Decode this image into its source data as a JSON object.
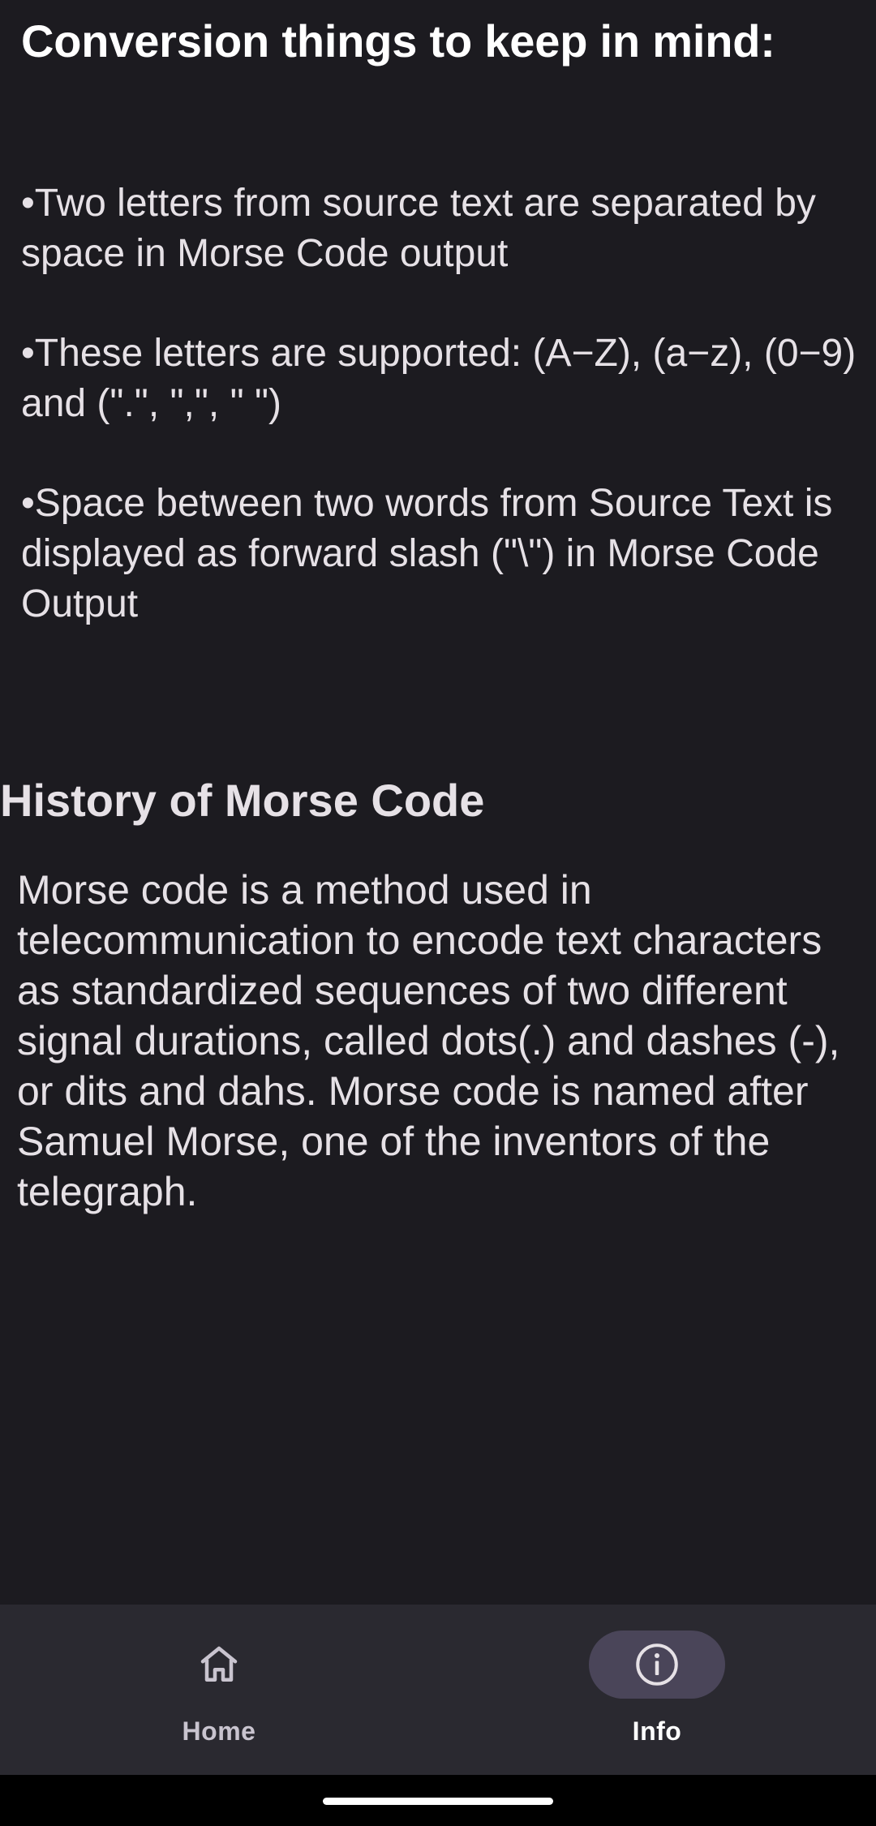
{
  "conversion": {
    "title": "Conversion things to keep in mind:",
    "notes": [
      "•Two letters from source text are separated by space in Morse Code output",
      "•These letters are supported: (A−Z), (a−z), (0−9) and (\".\", \",\", \" \")",
      "•Space between two words from Source Text is displayed as forward slash (\"\\\") in Morse Code Output"
    ]
  },
  "history": {
    "title": "History of Morse Code",
    "body": "Morse code is a method used in telecommunication to encode text characters as standardized sequences of two different signal durations, called dots(.) and dashes (-), or dits and dahs. Morse code is named after Samuel Morse, one of the inventors of the telegraph."
  },
  "bottom_nav": {
    "items": [
      {
        "label": "Home",
        "icon": "home-icon",
        "selected": false
      },
      {
        "label": "Info",
        "icon": "info-icon",
        "selected": true
      }
    ]
  },
  "colors": {
    "background": "#1c1b20",
    "nav_background": "#2a2930",
    "selected_pill": "#4a4559",
    "text": "#e6e1e6"
  }
}
